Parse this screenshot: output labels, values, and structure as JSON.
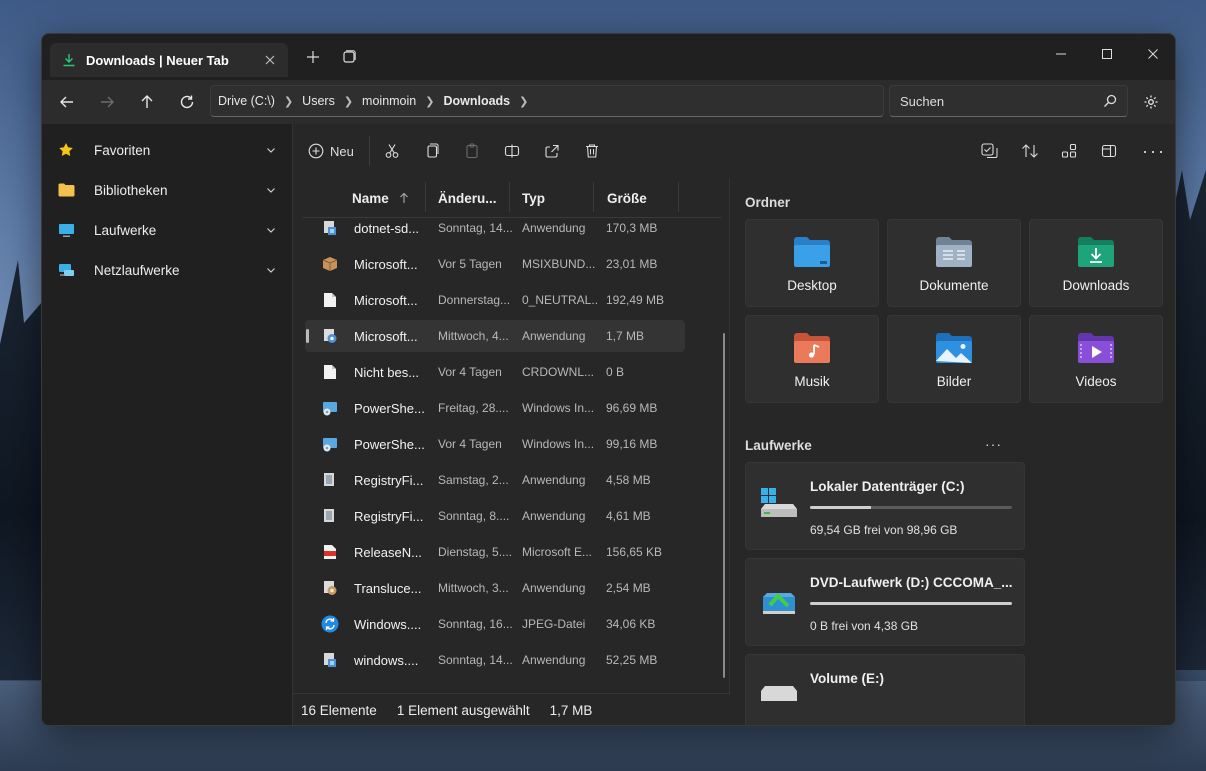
{
  "tab": {
    "title": "Downloads | Neuer Tab"
  },
  "breadcrumb": [
    "Drive (C:\\)",
    "Users",
    "moinmoin",
    "Downloads"
  ],
  "search": {
    "placeholder": "Suchen"
  },
  "sidebar": {
    "items": [
      {
        "label": "Favoriten",
        "icon": "star-icon"
      },
      {
        "label": "Bibliotheken",
        "icon": "folder-icon"
      },
      {
        "label": "Laufwerke",
        "icon": "monitor-icon"
      },
      {
        "label": "Netzlaufwerke",
        "icon": "network-drive-icon"
      }
    ]
  },
  "toolbar": {
    "new_label": "Neu"
  },
  "columns": {
    "name": "Name",
    "modified": "Änderu...",
    "type": "Typ",
    "size": "Größe"
  },
  "files": [
    {
      "name": "dotnet-sd...",
      "date": "Sonntag, 14...",
      "type": "Anwendung",
      "size": "170,3 MB",
      "icon": "installer-icon"
    },
    {
      "name": "Microsoft...",
      "date": "Vor 5 Tagen",
      "type": "MSIXBUND...",
      "size": "23,01 MB",
      "icon": "package-icon"
    },
    {
      "name": "Microsoft...",
      "date": "Donnerstag...",
      "type": "0_NEUTRAL...",
      "size": "192,49 MB",
      "icon": "file-icon"
    },
    {
      "name": "Microsoft...",
      "date": "Mittwoch, 4...",
      "type": "Anwendung",
      "size": "1,7 MB",
      "icon": "setup-icon"
    },
    {
      "name": "Nicht bes...",
      "date": "Vor 4 Tagen",
      "type": "CRDOWNL...",
      "size": "0 B",
      "icon": "file-icon"
    },
    {
      "name": "PowerShe...",
      "date": "Freitag, 28....",
      "type": "Windows In...",
      "size": "96,69 MB",
      "icon": "msi-icon"
    },
    {
      "name": "PowerShe...",
      "date": "Vor 4 Tagen",
      "type": "Windows In...",
      "size": "99,16 MB",
      "icon": "msi-icon"
    },
    {
      "name": "RegistryFi...",
      "date": "Samstag, 2...",
      "type": "Anwendung",
      "size": "4,58 MB",
      "icon": "installer-icon"
    },
    {
      "name": "RegistryFi...",
      "date": "Sonntag, 8....",
      "type": "Anwendung",
      "size": "4,61 MB",
      "icon": "installer-icon"
    },
    {
      "name": "ReleaseN...",
      "date": "Dienstag, 5....",
      "type": "Microsoft E...",
      "size": "156,65 KB",
      "icon": "pdf-icon"
    },
    {
      "name": "Transluce...",
      "date": "Mittwoch, 3...",
      "type": "Anwendung",
      "size": "2,54 MB",
      "icon": "setup-icon"
    },
    {
      "name": "Windows....",
      "date": "Sonntag, 16...",
      "type": "JPEG-Datei",
      "size": "34,06 KB",
      "icon": "sync-icon"
    },
    {
      "name": "windows....",
      "date": "Sonntag, 14...",
      "type": "Anwendung",
      "size": "52,25 MB",
      "icon": "installer-icon"
    }
  ],
  "status": {
    "count": "16 Elemente",
    "selected": "1 Element ausgewählt",
    "size": "1,7 MB"
  },
  "home": {
    "folders_title": "Ordner",
    "folders": [
      {
        "label": "Desktop",
        "icon": "desktop-folder-icon",
        "color": "#3aa0e8"
      },
      {
        "label": "Dokumente",
        "icon": "documents-folder-icon",
        "color": "#8fa3b8"
      },
      {
        "label": "Downloads",
        "icon": "downloads-folder-icon",
        "color": "#1fa37a"
      },
      {
        "label": "Musik",
        "icon": "music-folder-icon",
        "color": "#e8744a"
      },
      {
        "label": "Bilder",
        "icon": "pictures-folder-icon",
        "color": "#2f8fe0"
      },
      {
        "label": "Videos",
        "icon": "videos-folder-icon",
        "color": "#8a4fd8"
      }
    ],
    "drives_title": "Laufwerke",
    "drives": [
      {
        "name": "Lokaler Datenträger (C:)",
        "free": "69,54 GB frei von 98,96 GB",
        "used_fraction": 0.3,
        "icon": "windows-drive-icon"
      },
      {
        "name": "DVD-Laufwerk (D:) CCCOMA_...",
        "free": "0 B frei von 4,38 GB",
        "used_fraction": 1.0,
        "icon": "dvd-drive-icon"
      },
      {
        "name": "Volume (E:)",
        "free": "",
        "used_fraction": 0,
        "icon": "hard-drive-icon"
      }
    ]
  }
}
